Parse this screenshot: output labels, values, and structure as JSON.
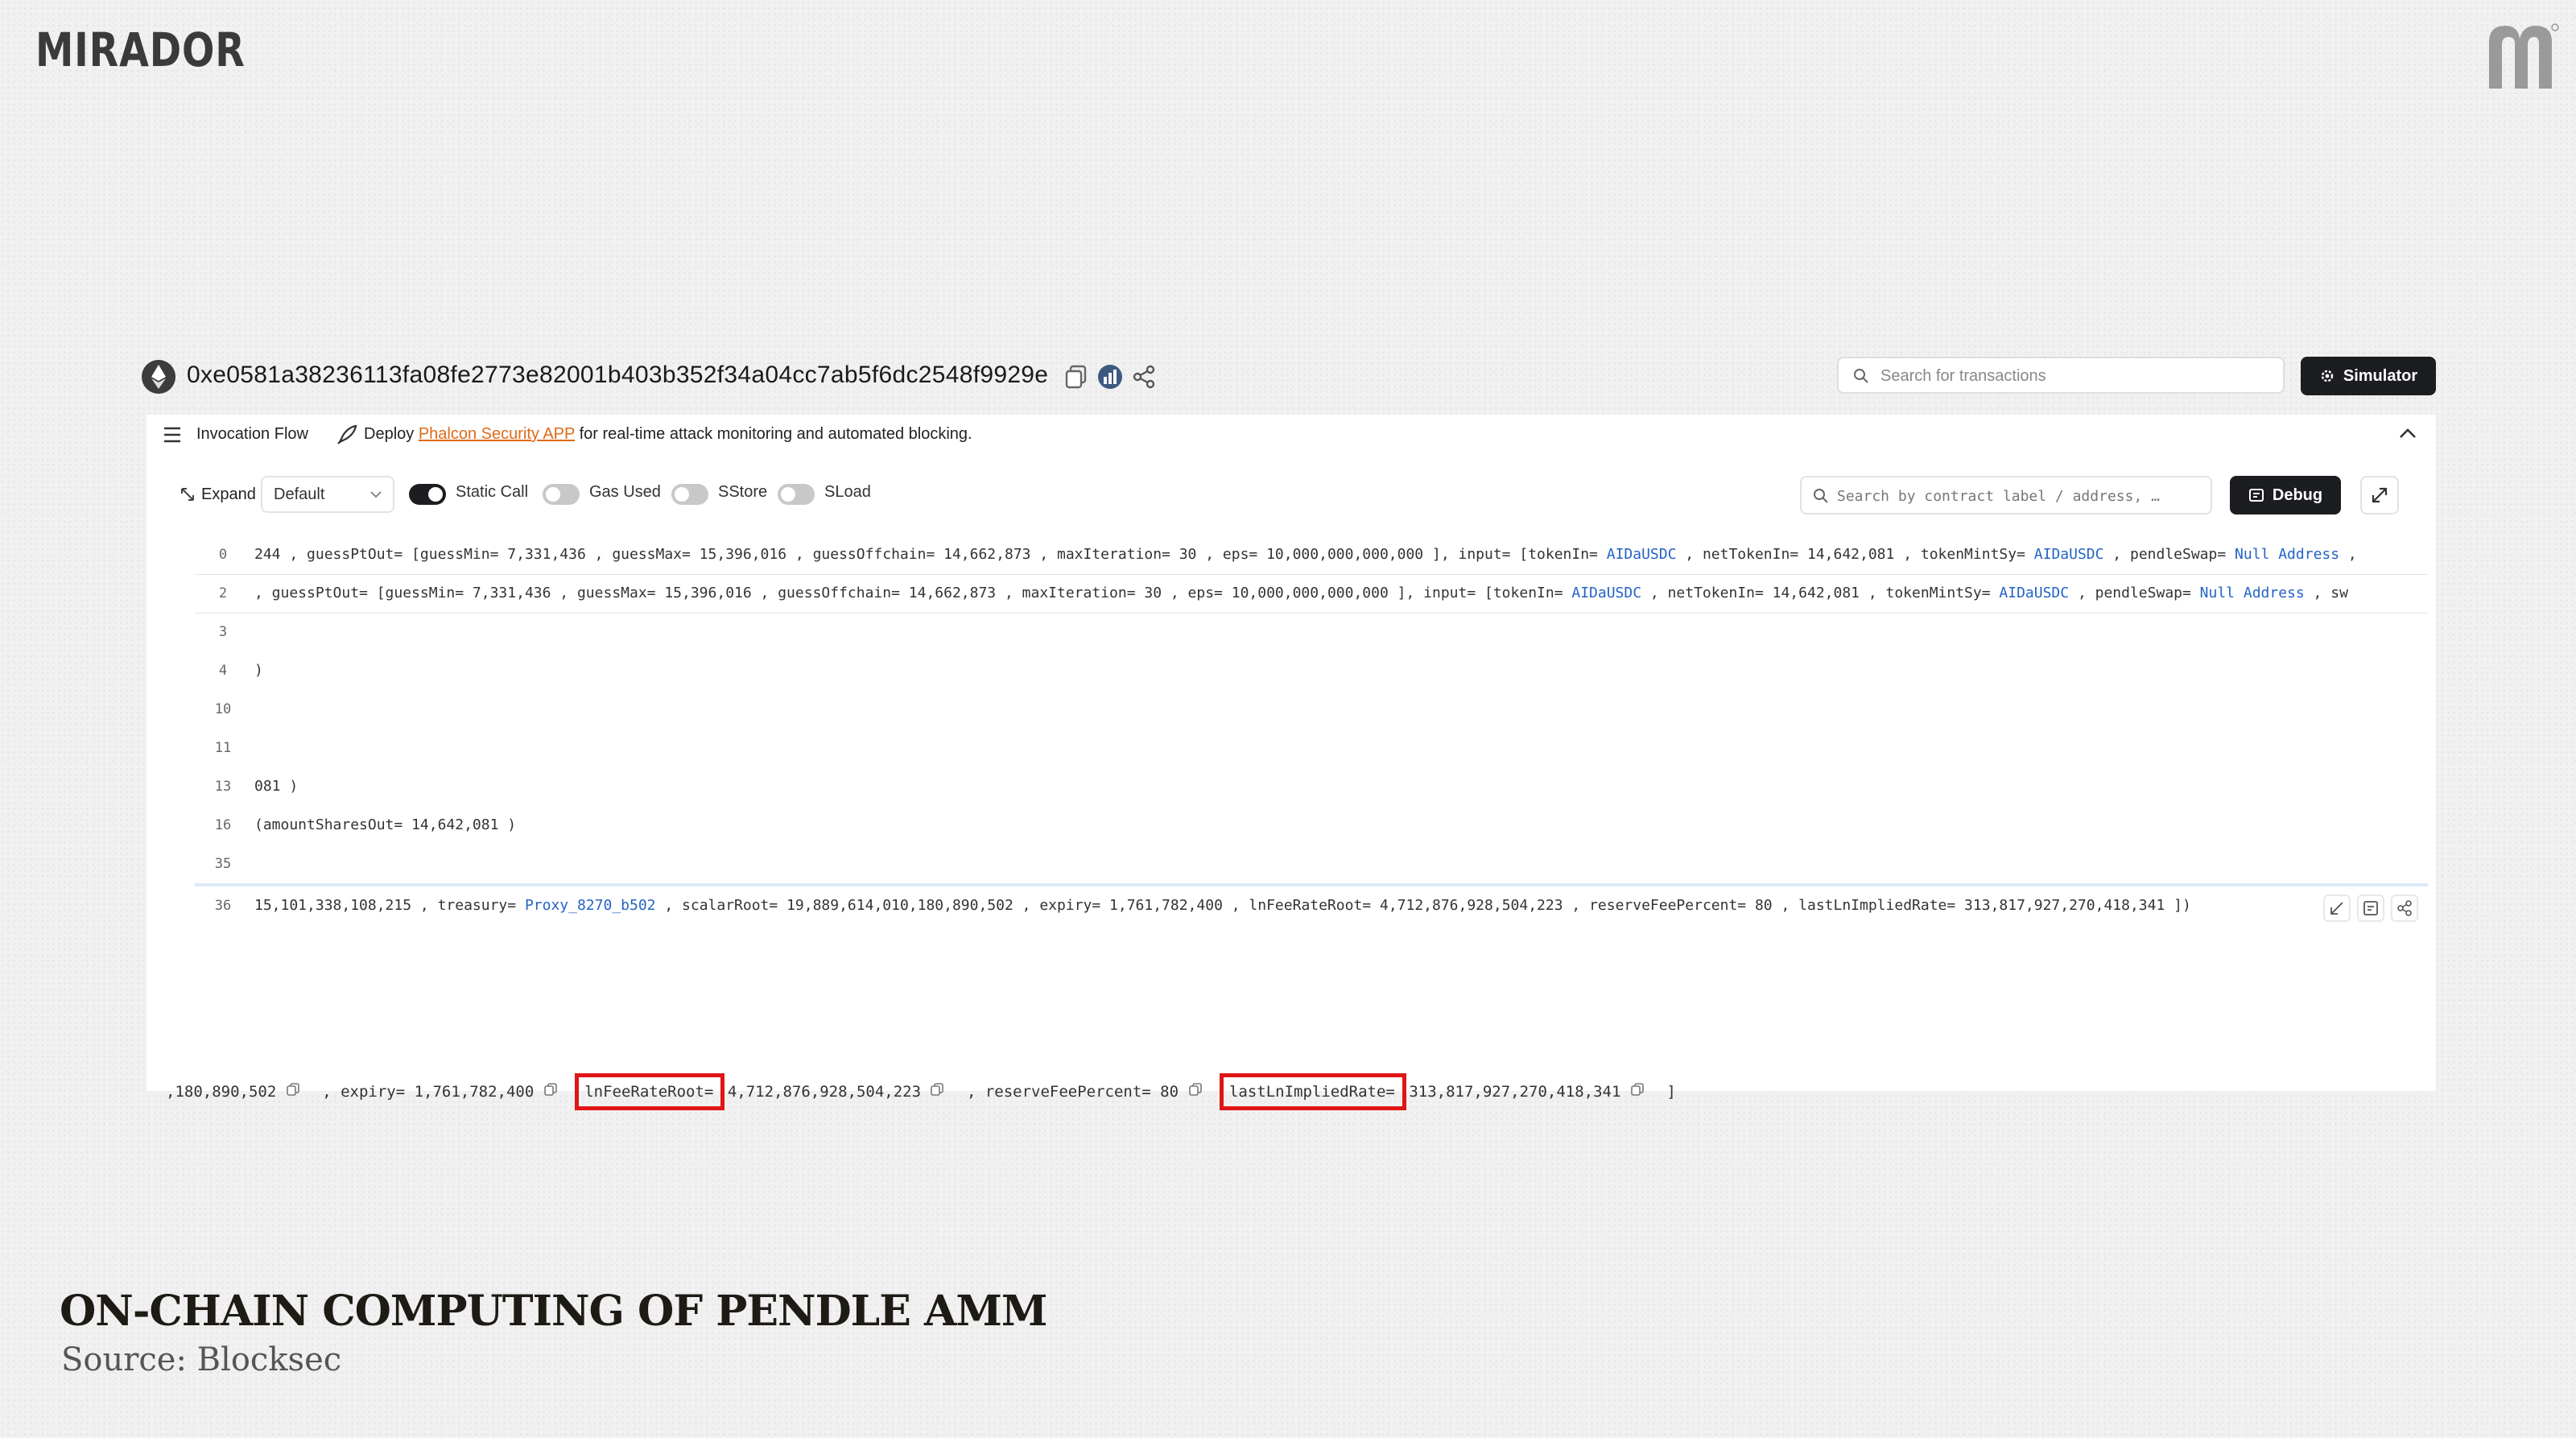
{
  "brand": {
    "name": "MIRADOR"
  },
  "tx": {
    "hash": "0xe0581a38236113fa08fe2773e82001b403b352f34a04cc7ab5f6dc2548f9929e",
    "search_placeholder": "Search for transactions",
    "simulator_label": "Simulator"
  },
  "flow_bar": {
    "label": "Invocation Flow",
    "deploy_prefix": "Deploy ",
    "deploy_link": "Phalcon Security APP",
    "deploy_suffix": " for real-time attack monitoring and automated blocking."
  },
  "controls": {
    "expand_label": "Expand",
    "expand_value": "Default",
    "toggles": [
      {
        "label": "Static Call",
        "on": true
      },
      {
        "label": "Gas Used",
        "on": false
      },
      {
        "label": "SStore",
        "on": false
      },
      {
        "label": "SLoad",
        "on": false
      }
    ],
    "contract_search_placeholder": "Search by contract label / address, …",
    "debug_label": "Debug"
  },
  "trace": {
    "rows": [
      {
        "line": "0",
        "parts": [
          [
            "244 , guessPtOut= [guessMin= 7,331,436 , guessMax= 15,396,016 , guessOffchain= 14,662,873 , maxIteration= 30 , eps= 10,000,000,000,000 ], input= [tokenIn= ",
            false
          ],
          [
            "AIDaUSDC",
            true
          ],
          [
            " , netTokenIn= 14,642,081 , tokenMintSy= ",
            false
          ],
          [
            "AIDaUSDC",
            true
          ],
          [
            " , pendleSwap= ",
            false
          ],
          [
            "Null Address",
            true
          ],
          [
            " ,",
            false
          ]
        ]
      },
      {
        "line": "2",
        "parts": [
          [
            ", guessPtOut= [guessMin= 7,331,436 , guessMax= 15,396,016 , guessOffchain= 14,662,873 , maxIteration= 30 , eps= 10,000,000,000,000 ], input= [tokenIn= ",
            false
          ],
          [
            "AIDaUSDC",
            true
          ],
          [
            " , netTokenIn= 14,642,081 , tokenMintSy= ",
            false
          ],
          [
            "AIDaUSDC",
            true
          ],
          [
            " , pendleSwap= ",
            false
          ],
          [
            "Null Address",
            true
          ],
          [
            " , sw",
            false
          ]
        ]
      },
      {
        "line": "3",
        "parts": []
      },
      {
        "line": "4",
        "parts": [
          [
            ")",
            false
          ]
        ]
      },
      {
        "line": "10",
        "parts": []
      },
      {
        "line": "11",
        "parts": []
      },
      {
        "line": "13",
        "parts": [
          [
            "081 )",
            false
          ]
        ]
      },
      {
        "line": "16",
        "parts": [
          [
            "(amountSharesOut= 14,642,081 )",
            false
          ]
        ]
      },
      {
        "line": "35",
        "parts": []
      },
      {
        "line": "36",
        "parts": [
          [
            "15,101,338,108,215 , treasury= ",
            false
          ],
          [
            "Proxy_8270_b502",
            true
          ],
          [
            " , scalarRoot= 19,889,614,010,180,890,502 , expiry= 1,761,782,400 , lnFeeRateRoot= 4,712,876,928,504,223 , reserveFeePercent= 80 , lastLnImpliedRate= 313,817,927,270,418,341 ])",
            false
          ]
        ]
      }
    ]
  },
  "detail": {
    "seg1": ",180,890,502",
    "seg2": ", expiry= 1,761,782,400",
    "key1": "lnFeeRateRoot=",
    "val1": "4,712,876,928,504,223",
    "seg3": ", reserveFeePercent= 80",
    "key2": "lastLnImpliedRate=",
    "val2": "313,817,927,270,418,341",
    "tail": "]"
  },
  "caption": {
    "title": "ON-CHAIN COMPUTING OF PENDLE AMM",
    "source": "Source: Blocksec"
  },
  "colors": {
    "highlight_red": "#e01515",
    "link_blue": "#2463c6",
    "link_orange": "#e06a17",
    "button_dark": "#1c1d20"
  },
  "icons": [
    "eth-logo-icon",
    "copy-icon",
    "chart-icon",
    "share-icon",
    "search-icon",
    "gear-icon",
    "menu-icon",
    "rocket-icon",
    "chevron-up-icon",
    "expand-icon",
    "chevron-down-icon",
    "debug-icon",
    "fullscreen-icon",
    "collapse-icon",
    "code-icon",
    "mirador-logo-icon"
  ]
}
